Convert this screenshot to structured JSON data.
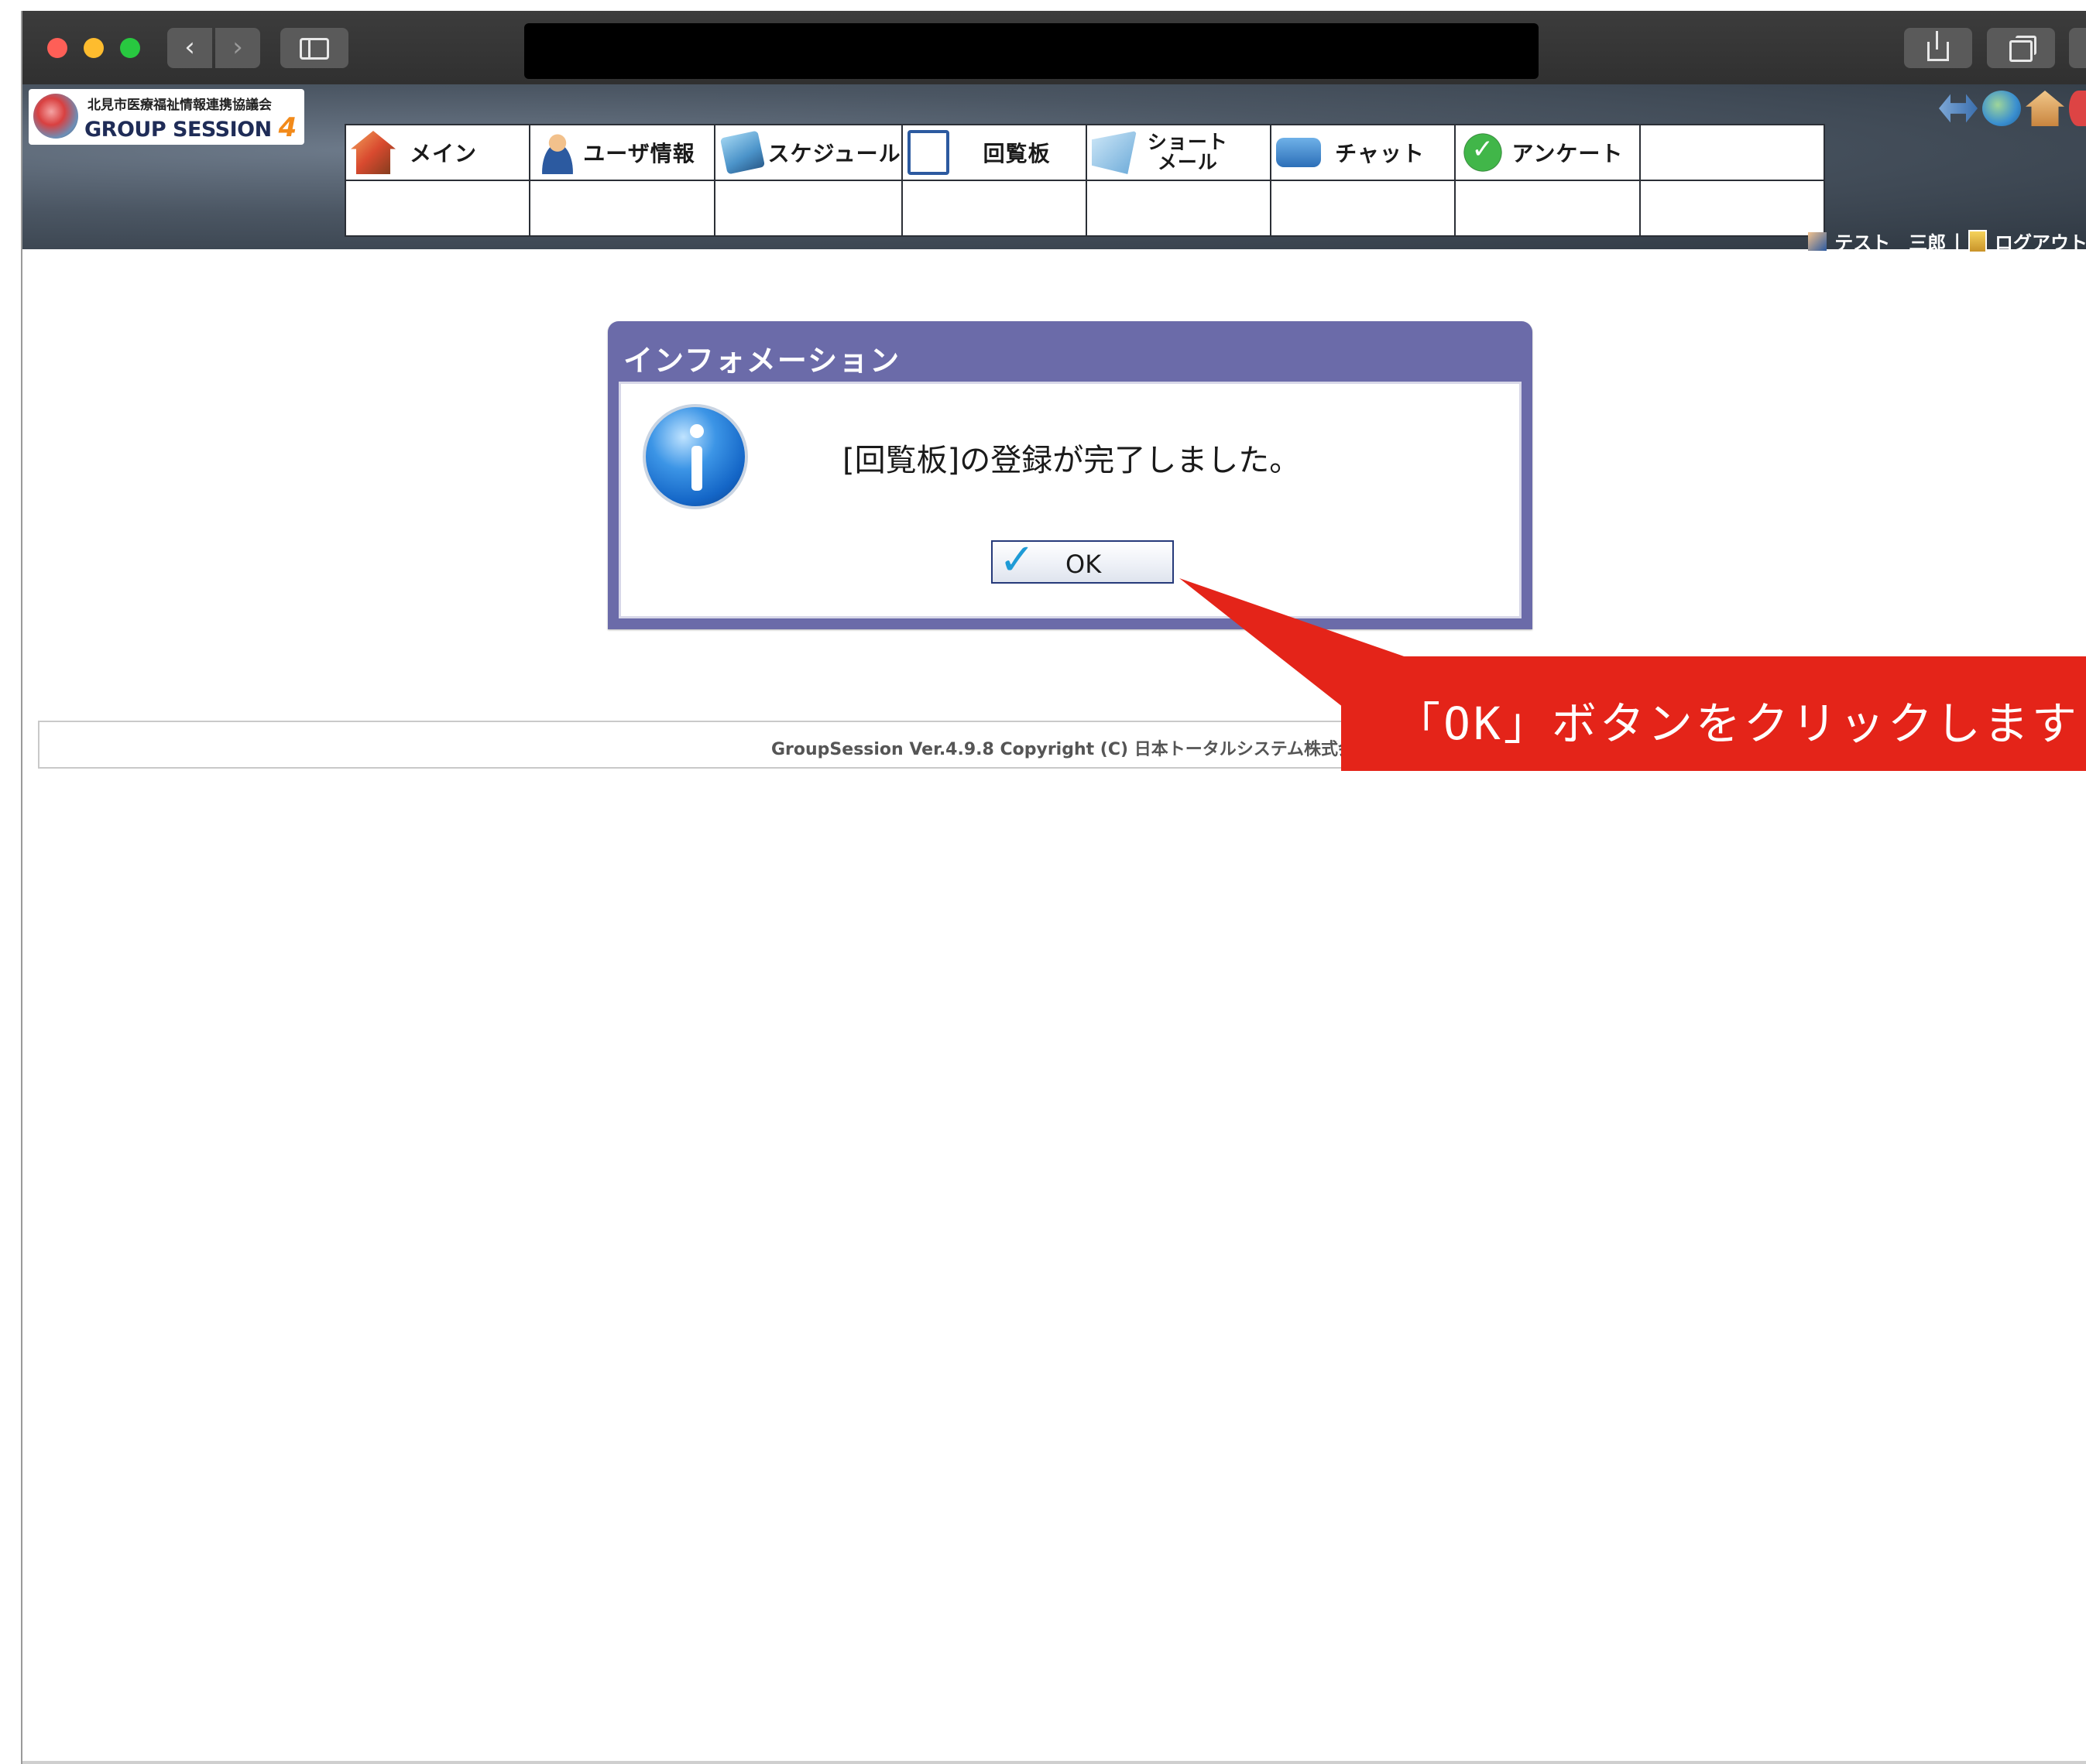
{
  "browser": {
    "back_glyph": "‹",
    "forward_glyph": "›"
  },
  "header": {
    "logo_subtitle": "北見市医療福祉情報連携協議会",
    "logo_title": "GROUP SESSION",
    "logo_version": "4",
    "menu": [
      {
        "label": "メイン",
        "icon": "home-icon"
      },
      {
        "label": "ユーザ情報",
        "icon": "user-icon"
      },
      {
        "label": "スケジュール",
        "icon": "schedule-icon"
      },
      {
        "label": "回覧板",
        "icon": "circular-icon"
      },
      {
        "label": "ショート\nメール",
        "icon": "short-mail-icon"
      },
      {
        "label": "チャット",
        "icon": "chat-icon"
      },
      {
        "label": "アンケート",
        "icon": "survey-icon"
      },
      {
        "label": "",
        "icon": ""
      }
    ],
    "user_name": "テスト　三郎",
    "separator": "|",
    "logout_label": "ログアウト"
  },
  "dialog": {
    "title": "インフォメーション",
    "message": "[回覧板]の登録が完了しました。",
    "ok_label": "OK"
  },
  "footer": {
    "copyright": "GroupSession Ver.4.9.8 Copyright (C) 日本トータルシステム株式会社"
  },
  "callout": {
    "text": "「OK」ボタンをクリックします"
  },
  "colors": {
    "dialog_frame": "#6b6ba9",
    "callout_bg": "#e42419",
    "header_bg": "#4b5663"
  }
}
